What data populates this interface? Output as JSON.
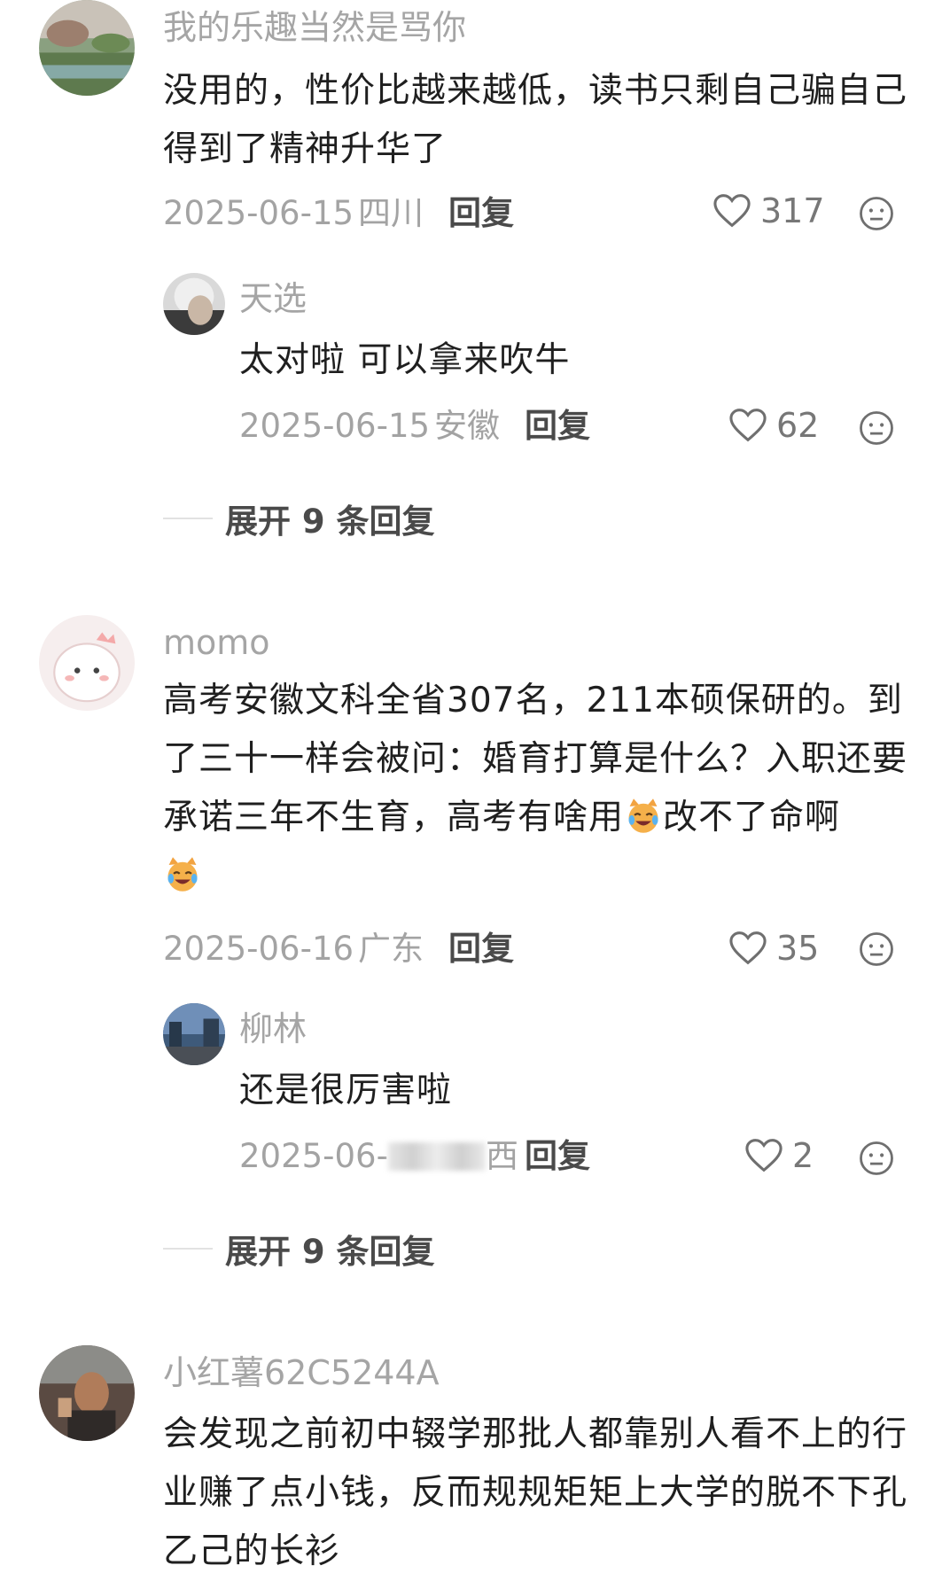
{
  "comments": [
    {
      "user": "我的乐趣当然是骂你",
      "text": "没用的，性价比越来越低，读书只剩自己骗自己得到了精神升华了",
      "date": "2025-06-15",
      "location": "四川",
      "reply_label": "回复",
      "likes": "317",
      "replies": [
        {
          "user": "天选",
          "text": "太对啦 可以拿来吹牛",
          "date": "2025-06-15",
          "location": "安徽",
          "reply_label": "回复",
          "likes": "62"
        }
      ],
      "expand_label": "展开 9 条回复"
    },
    {
      "user": "momo",
      "text_part1": "高考安徽文科全省307名，211本硕保研的。到了三十一样会被问：婚育打算是什么？入职还要承诺三年不生育，高考有啥用",
      "text_part2": "改不了命啊",
      "date": "2025-06-16",
      "location": "广东",
      "reply_label": "回复",
      "likes": "35",
      "replies": [
        {
          "user": "柳林",
          "text": "还是很厉害啦",
          "date_partial": "2025-06-",
          "location_partial": "西",
          "reply_label": "回复",
          "likes": "2"
        }
      ],
      "expand_label": "展开 9 条回复"
    },
    {
      "user": "小红薯62C5244A",
      "text": "会发现之前初中辍学那批人都靠别人看不上的行业赚了点小钱，反而规规矩矩上大学的脱不下孔乙己的长衫"
    }
  ],
  "icons": {
    "like": "heart-outline-icon",
    "dislike": "neutral-face-icon",
    "emoji": "crying-laughing-cat-emoji"
  },
  "colors": {
    "username": "#a5a5a5",
    "text": "#1f1f1f",
    "meta": "#a3a3a3"
  }
}
